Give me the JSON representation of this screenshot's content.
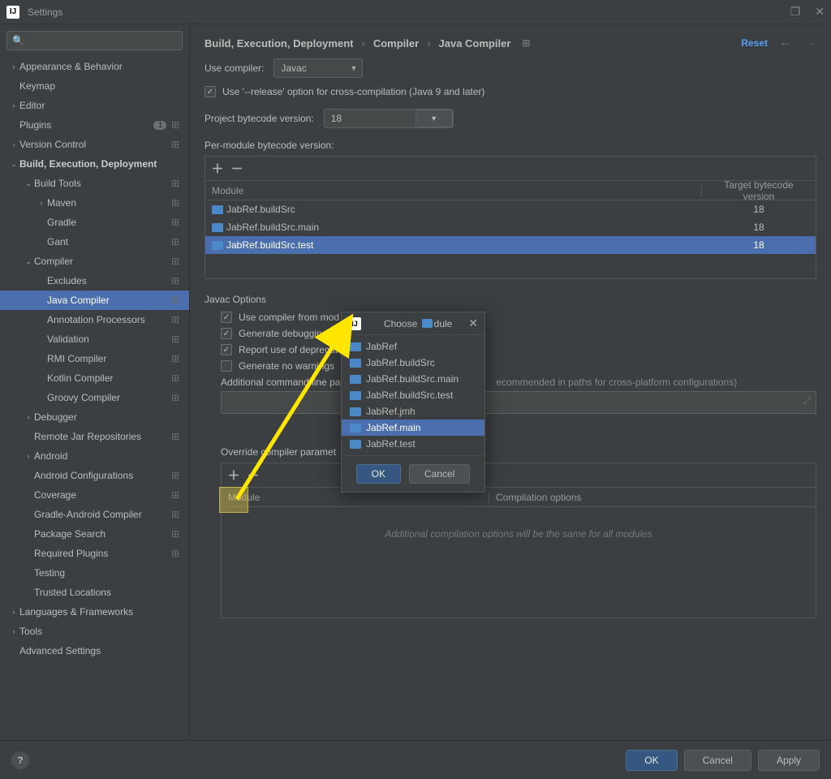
{
  "window": {
    "title": "Settings"
  },
  "sidebar": {
    "search_placeholder": "",
    "items": [
      {
        "label": "Appearance & Behavior",
        "indent": 0,
        "expander": "›",
        "tail": "",
        "badge": ""
      },
      {
        "label": "Keymap",
        "indent": 0,
        "expander": "",
        "tail": "",
        "badge": ""
      },
      {
        "label": "Editor",
        "indent": 0,
        "expander": "›",
        "tail": "",
        "badge": ""
      },
      {
        "label": "Plugins",
        "indent": 0,
        "expander": "",
        "tail": "⊞",
        "badge": "1"
      },
      {
        "label": "Version Control",
        "indent": 0,
        "expander": "›",
        "tail": "⊞",
        "badge": ""
      },
      {
        "label": "Build, Execution, Deployment",
        "indent": 0,
        "expander": "⌄",
        "tail": "",
        "badge": "",
        "bold": true
      },
      {
        "label": "Build Tools",
        "indent": 1,
        "expander": "⌄",
        "tail": "⊞",
        "badge": ""
      },
      {
        "label": "Maven",
        "indent": 2,
        "expander": "›",
        "tail": "⊞",
        "badge": ""
      },
      {
        "label": "Gradle",
        "indent": 2,
        "expander": "",
        "tail": "⊞",
        "badge": ""
      },
      {
        "label": "Gant",
        "indent": 2,
        "expander": "",
        "tail": "⊞",
        "badge": ""
      },
      {
        "label": "Compiler",
        "indent": 1,
        "expander": "⌄",
        "tail": "⊞",
        "badge": ""
      },
      {
        "label": "Excludes",
        "indent": 2,
        "expander": "",
        "tail": "⊞",
        "badge": ""
      },
      {
        "label": "Java Compiler",
        "indent": 2,
        "expander": "",
        "tail": "⊞",
        "badge": "",
        "selected": true
      },
      {
        "label": "Annotation Processors",
        "indent": 2,
        "expander": "",
        "tail": "⊞",
        "badge": ""
      },
      {
        "label": "Validation",
        "indent": 2,
        "expander": "",
        "tail": "⊞",
        "badge": ""
      },
      {
        "label": "RMI Compiler",
        "indent": 2,
        "expander": "",
        "tail": "⊞",
        "badge": ""
      },
      {
        "label": "Kotlin Compiler",
        "indent": 2,
        "expander": "",
        "tail": "⊞",
        "badge": ""
      },
      {
        "label": "Groovy Compiler",
        "indent": 2,
        "expander": "",
        "tail": "⊞",
        "badge": ""
      },
      {
        "label": "Debugger",
        "indent": 1,
        "expander": "›",
        "tail": "",
        "badge": ""
      },
      {
        "label": "Remote Jar Repositories",
        "indent": 1,
        "expander": "",
        "tail": "⊞",
        "badge": ""
      },
      {
        "label": "Android",
        "indent": 1,
        "expander": "›",
        "tail": "",
        "badge": ""
      },
      {
        "label": "Android Configurations",
        "indent": 1,
        "expander": "",
        "tail": "⊞",
        "badge": ""
      },
      {
        "label": "Coverage",
        "indent": 1,
        "expander": "",
        "tail": "⊞",
        "badge": ""
      },
      {
        "label": "Gradle-Android Compiler",
        "indent": 1,
        "expander": "",
        "tail": "⊞",
        "badge": ""
      },
      {
        "label": "Package Search",
        "indent": 1,
        "expander": "",
        "tail": "⊞",
        "badge": ""
      },
      {
        "label": "Required Plugins",
        "indent": 1,
        "expander": "",
        "tail": "⊞",
        "badge": ""
      },
      {
        "label": "Testing",
        "indent": 1,
        "expander": "",
        "tail": "",
        "badge": ""
      },
      {
        "label": "Trusted Locations",
        "indent": 1,
        "expander": "",
        "tail": "",
        "badge": ""
      },
      {
        "label": "Languages & Frameworks",
        "indent": 0,
        "expander": "›",
        "tail": "",
        "badge": ""
      },
      {
        "label": "Tools",
        "indent": 0,
        "expander": "›",
        "tail": "",
        "badge": ""
      },
      {
        "label": "Advanced Settings",
        "indent": 0,
        "expander": "",
        "tail": "",
        "badge": ""
      }
    ]
  },
  "breadcrumb": {
    "p0": "Build, Execution, Deployment",
    "p1": "Compiler",
    "p2": "Java Compiler",
    "reset": "Reset"
  },
  "form": {
    "use_compiler_label": "Use compiler:",
    "use_compiler_value": "Javac",
    "release_option": "Use '--release' option for cross-compilation (Java 9 and later)",
    "bytecode_label": "Project bytecode version:",
    "bytecode_value": "18",
    "per_module_label": "Per-module bytecode version:",
    "module_col": "Module",
    "target_col": "Target bytecode version",
    "modules": [
      {
        "name": "JabRef.buildSrc",
        "ver": "18"
      },
      {
        "name": "JabRef.buildSrc.main",
        "ver": "18"
      },
      {
        "name": "JabRef.buildSrc.test",
        "ver": "18",
        "selected": true
      }
    ],
    "javac_head": "Javac Options",
    "opt_module": "Use compiler from mod",
    "opt_debug": "Generate debugging in",
    "opt_deprec": "Report use of deprecat",
    "opt_nowarn": "Generate no warnings",
    "addl_label": "Additional command line pa",
    "addl_hint": "ecommended in paths for cross-platform configurations)",
    "override_head": "Override compiler paramet",
    "override_col1": "Module",
    "override_col2": "Compilation options",
    "empty_hint": "Additional compilation options will be the same for all modules"
  },
  "dialog": {
    "title_pre": "Choose",
    "title_post": "dule",
    "items": [
      {
        "name": "JabRef"
      },
      {
        "name": "JabRef.buildSrc"
      },
      {
        "name": "JabRef.buildSrc.main"
      },
      {
        "name": "JabRef.buildSrc.test"
      },
      {
        "name": "JabRef.jmh"
      },
      {
        "name": "JabRef.main",
        "selected": true
      },
      {
        "name": "JabRef.test"
      }
    ],
    "ok": "OK",
    "cancel": "Cancel"
  },
  "footer": {
    "ok": "OK",
    "cancel": "Cancel",
    "apply": "Apply",
    "help": "?"
  }
}
